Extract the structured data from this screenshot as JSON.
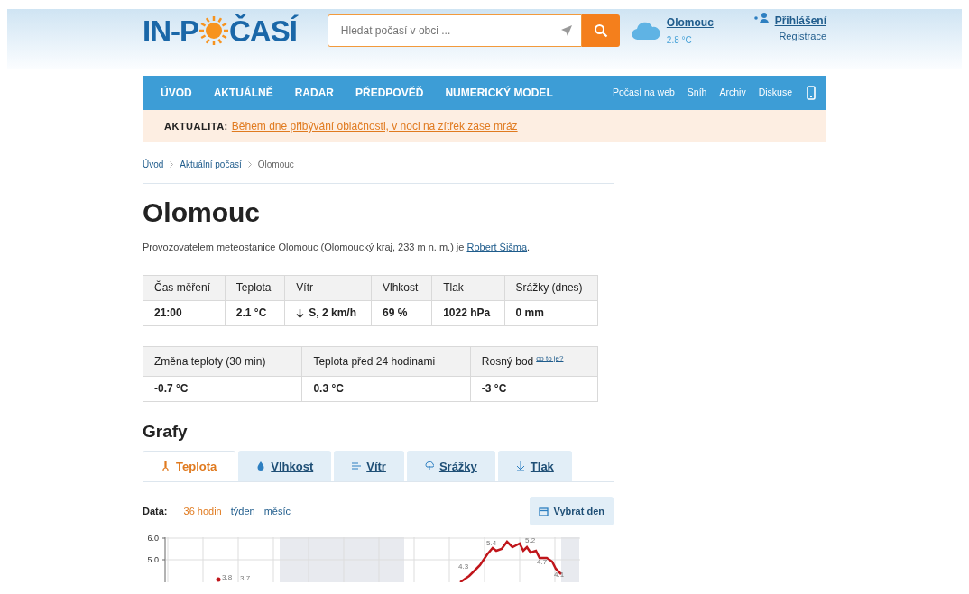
{
  "header": {
    "logo": {
      "before": "IN-P",
      "after": "ČASÍ"
    },
    "search": {
      "placeholder": "Hledat počasí v obci ..."
    },
    "weather": {
      "place": "Olomouc",
      "temperature": "2.8 °C"
    },
    "login": "Přihlášení",
    "register": "Registrace"
  },
  "nav": {
    "items": [
      {
        "label": "ÚVOD",
        "selected": false
      },
      {
        "label": "AKTUÁLNĚ",
        "selected": false
      },
      {
        "label": "RADAR",
        "selected": false
      },
      {
        "label": "PŘEDPOVĚĎ",
        "selected": false
      },
      {
        "label": "NUMERICKÝ MODEL",
        "selected": false
      }
    ],
    "links": [
      "Počasí na web",
      "Sníh",
      "Archiv",
      "Diskuse"
    ]
  },
  "alert": {
    "label": "AKTUALITA:",
    "text": "Během dne přibývání oblačnosti, v noci na zítřek zase mráz"
  },
  "breadcrumb": [
    {
      "label": "Úvod",
      "kind": "link"
    },
    {
      "label": "Aktuální počasí",
      "kind": "link"
    },
    {
      "label": "Olomouc",
      "kind": "current"
    }
  ],
  "title": "Olomouc",
  "operator": {
    "text": "Provozovatelem meteostanice Olomouc (Olomoucký kraj, 233 m n. m.) je ",
    "link": "Robert Šišma",
    "end": "."
  },
  "table1": {
    "columns": [
      "Čas měření",
      "Teplota",
      "Vítr",
      "Vlhkost",
      "Tlak",
      "Srážky (dnes)"
    ],
    "rows": [
      [
        {
          "text": "21:00"
        },
        {
          "text": "2.1 °C"
        },
        {
          "text": "S, 2 km/h",
          "kind": "wind"
        },
        {
          "text": "69 %"
        },
        {
          "text": "1022 hPa"
        },
        {
          "text": "0 mm"
        }
      ]
    ]
  },
  "table2": {
    "columns": [
      {
        "label": "Změna teploty (30 min)"
      },
      {
        "label": "Teplota před 24 hodinami"
      },
      {
        "label": "Rosný bod",
        "help": "co to je?"
      }
    ],
    "rows": [
      [
        "-0.7 °C",
        "0.3 °C",
        "-3 °C"
      ]
    ]
  },
  "charts_title": "Grafy",
  "tabs": [
    {
      "label": "Teplota",
      "kind": "temperature",
      "selected": true
    },
    {
      "label": "Vlhkost",
      "kind": "humidity",
      "selected": false
    },
    {
      "label": "Vítr",
      "kind": "wind",
      "selected": false
    },
    {
      "label": "Srážky",
      "kind": "rain",
      "selected": false
    },
    {
      "label": "Tlak",
      "kind": "pressure",
      "selected": false
    }
  ],
  "data_range": {
    "label": "Data:",
    "options": [
      {
        "label": "36 hodin",
        "selected": true
      },
      {
        "label": "týden",
        "selected": false
      },
      {
        "label": "měsíc",
        "selected": false
      }
    ]
  },
  "pick_day": "Vybrat den",
  "chart": {
    "y_labels": [
      "6.0",
      "5.0"
    ],
    "point_labels": [
      "3.8",
      "3.7",
      "4.3",
      "5.4",
      "5.2",
      "4.7",
      "4.1"
    ]
  }
}
